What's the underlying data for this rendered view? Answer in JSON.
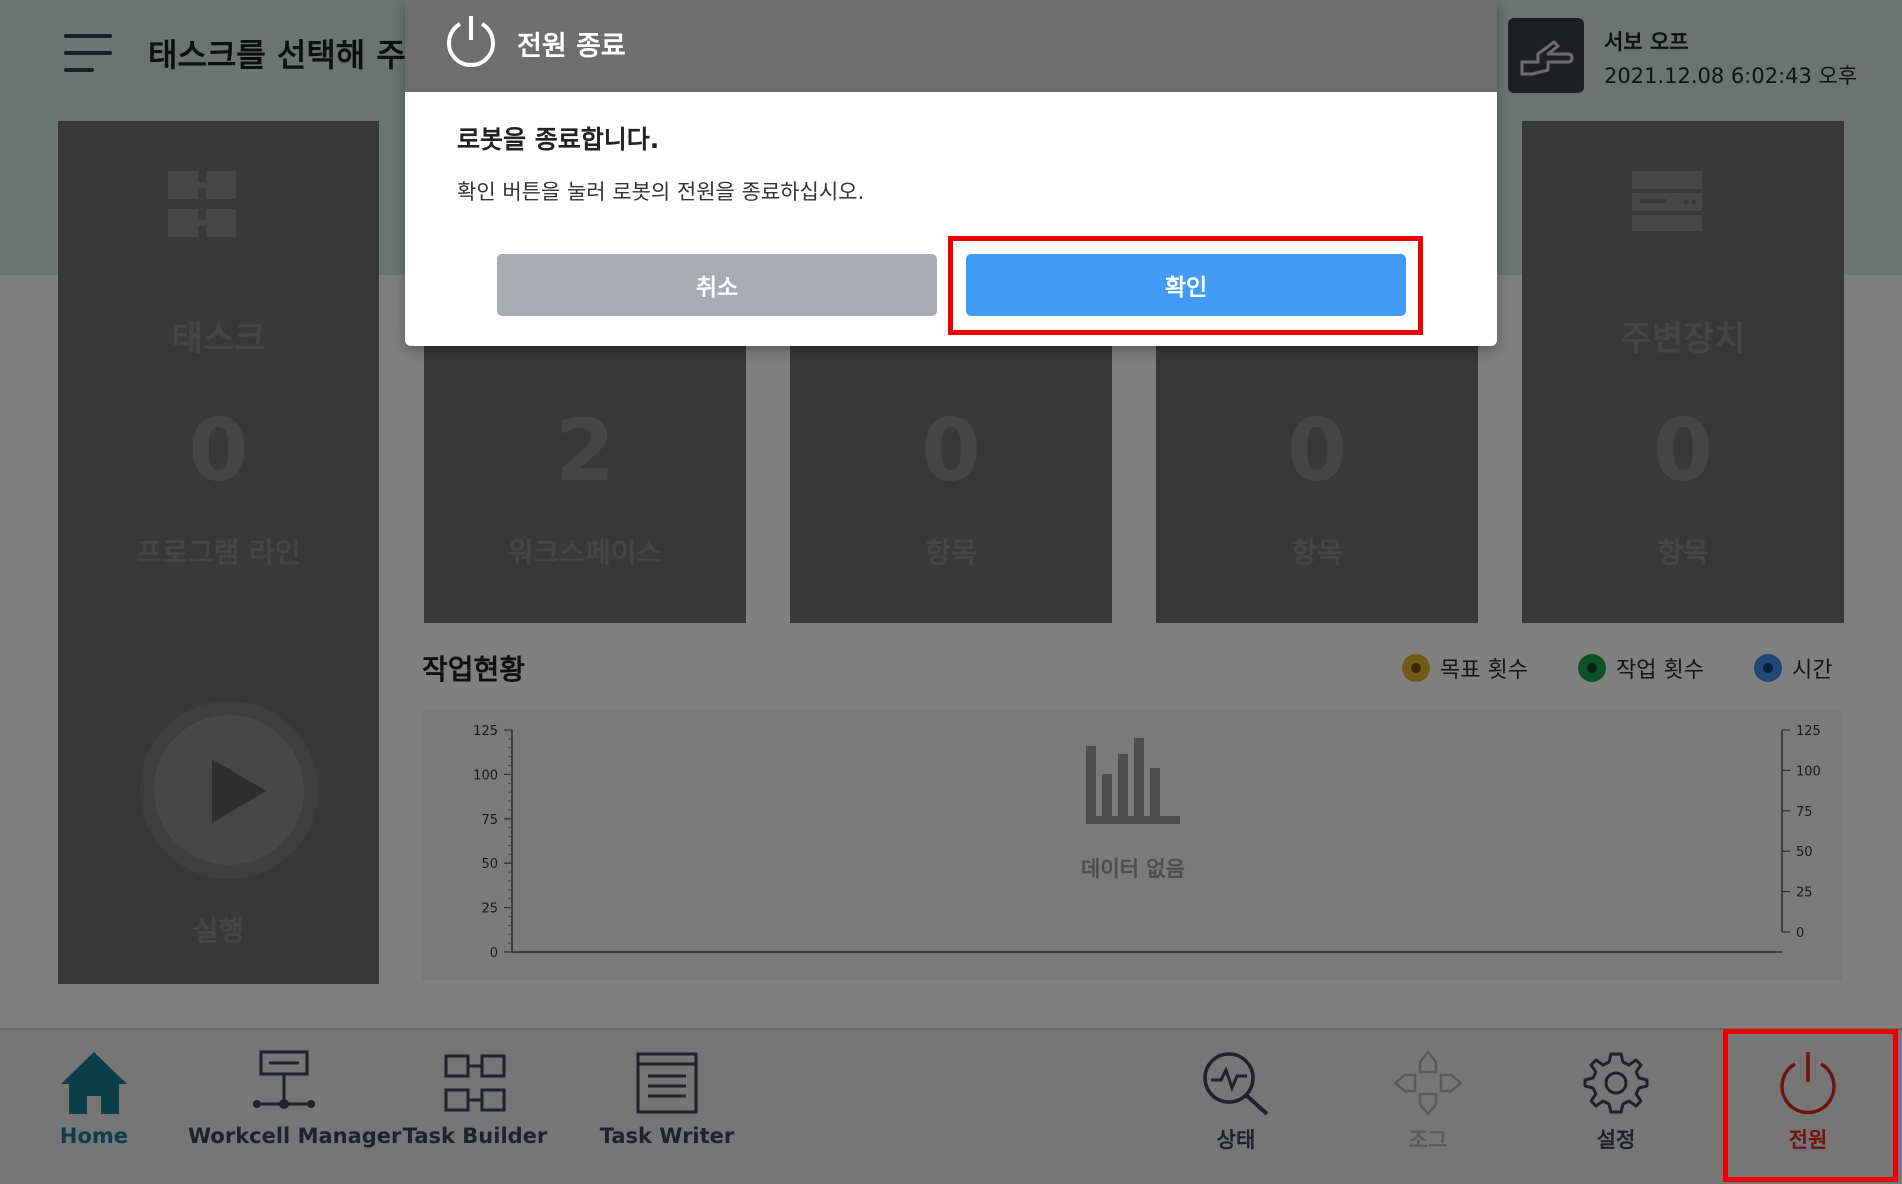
{
  "header": {
    "title": "태스크를 선택해 주",
    "servo_status": "서보 오프",
    "datetime": "2021.12.08 6:02:43 오후"
  },
  "cards": [
    {
      "title": "태스크",
      "value": "0",
      "unit": "프로그램 라인"
    },
    {
      "title": "",
      "value": "2",
      "unit": "워크스페이스"
    },
    {
      "title": "",
      "value": "0",
      "unit": "항목"
    },
    {
      "title": "",
      "value": "0",
      "unit": "항목"
    },
    {
      "title": "주변장치",
      "value": "0",
      "unit": "항목"
    }
  ],
  "run": {
    "label": "실행"
  },
  "status_panel": {
    "title": "작업현황",
    "legend": [
      {
        "label": "목표 횟수",
        "color": "#e0b531"
      },
      {
        "label": "작업 횟수",
        "color": "#17a755"
      },
      {
        "label": "시간",
        "color": "#3f8ff0"
      }
    ],
    "no_data": "데이터 없음"
  },
  "chart_data": {
    "type": "bar",
    "series": [],
    "left_ticks": [
      "0",
      "25",
      "50",
      "75",
      "100",
      "125"
    ],
    "right_ticks": [
      "0",
      "25",
      "50",
      "75",
      "100",
      "125"
    ],
    "ylim": [
      0,
      125
    ],
    "ylim_right": [
      0,
      125
    ]
  },
  "bottom_nav": {
    "home": "Home",
    "workcell_manager": "Workcell Manager",
    "task_builder": "Task Builder",
    "task_writer": "Task Writer",
    "status": "상태",
    "jog": "조그",
    "settings": "설정",
    "power": "전원",
    "colors": {
      "active": "#1a7e96",
      "default": "#3e4550",
      "disabled": "#b0b3b8",
      "power": "#e02424"
    }
  },
  "dialog": {
    "title": "전원 종료",
    "heading": "로봇을 종료합니다.",
    "message": "확인 버튼을 눌러 로봇의 전원을 종료하십시오.",
    "cancel_label": "취소",
    "confirm_label": "확인"
  }
}
